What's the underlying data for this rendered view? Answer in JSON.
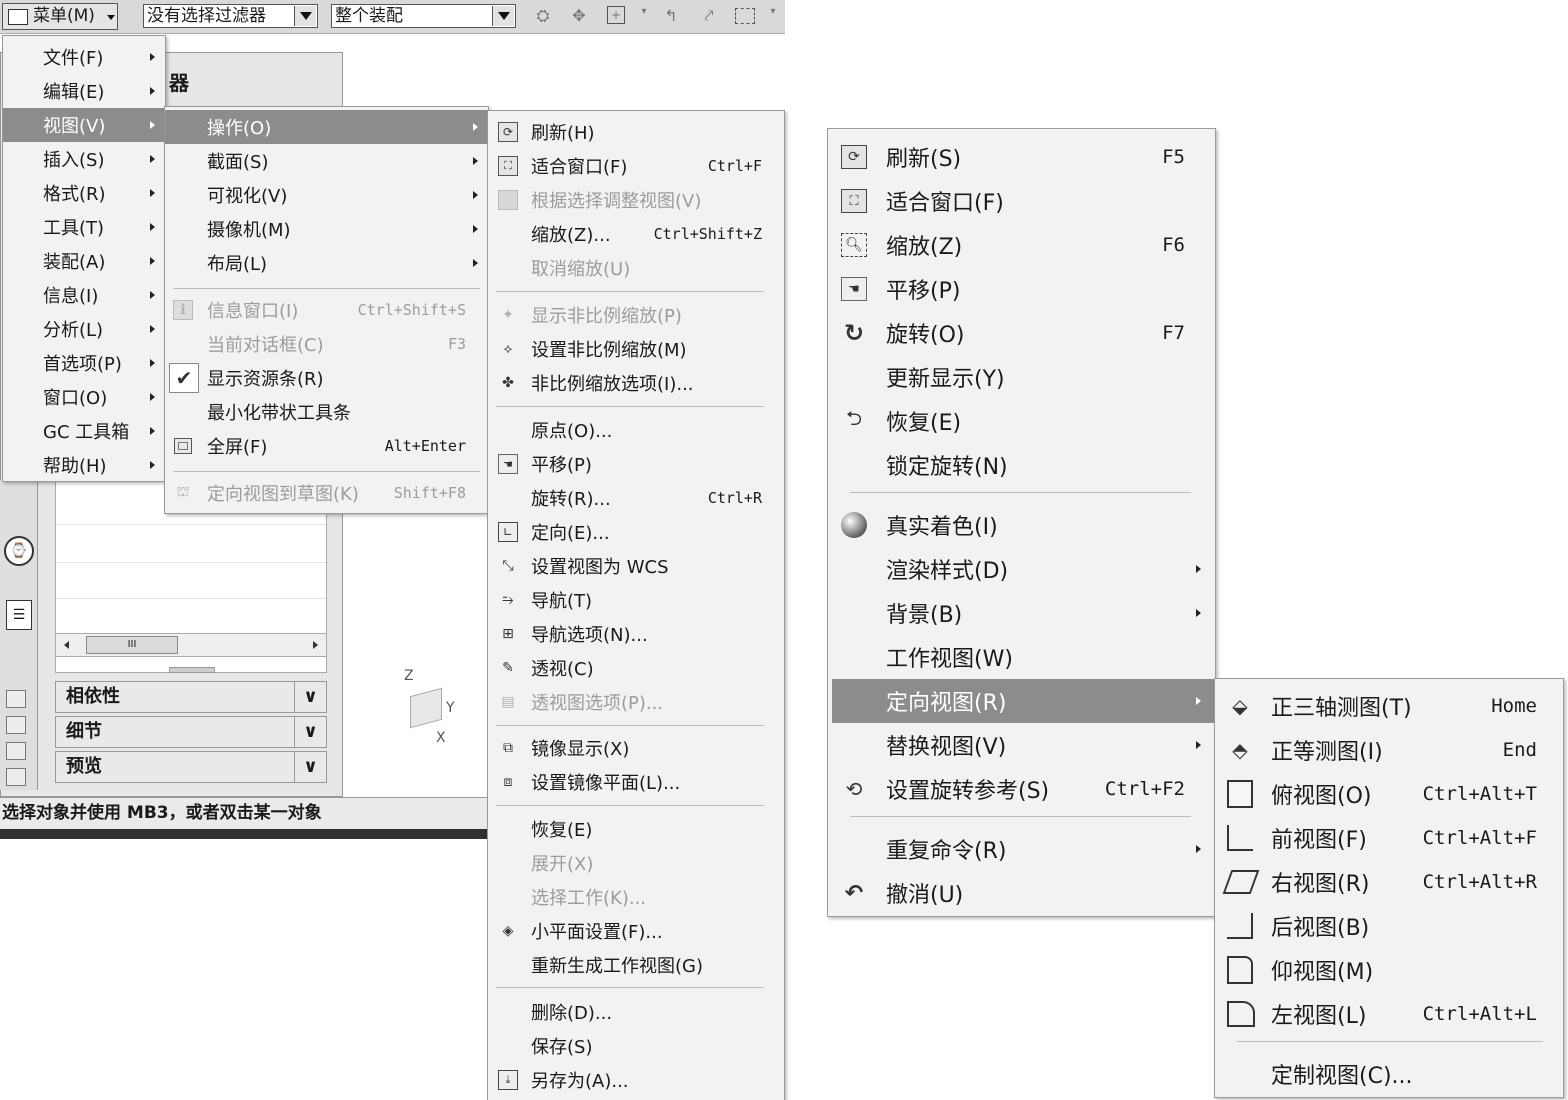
{
  "toolbar": {
    "menu_button": "菜单(M)",
    "filter": "没有选择过滤器",
    "scope": "整个装配"
  },
  "panel": {
    "title_fragment": "器",
    "sections": [
      "相依性",
      "细节",
      "预览"
    ],
    "status": "选择对象并使用 MB3，或者双击某一对象",
    "scroll_mark": "III"
  },
  "axes": {
    "z": "Z",
    "y": "Y",
    "x": "X"
  },
  "main_menu": [
    {
      "label": "文件(F)"
    },
    {
      "label": "编辑(E)"
    },
    {
      "label": "视图(V)"
    },
    {
      "label": "插入(S)"
    },
    {
      "label": "格式(R)"
    },
    {
      "label": "工具(T)"
    },
    {
      "label": "装配(A)"
    },
    {
      "label": "信息(I)"
    },
    {
      "label": "分析(L)"
    },
    {
      "label": "首选项(P)"
    },
    {
      "label": "窗口(O)"
    },
    {
      "label": "GC 工具箱"
    },
    {
      "label": "帮助(H)"
    }
  ],
  "view_menu": [
    {
      "label": "操作(O)",
      "shortcut": ""
    },
    {
      "label": "截面(S)",
      "shortcut": ""
    },
    {
      "label": "可视化(V)",
      "shortcut": ""
    },
    {
      "label": "摄像机(M)",
      "shortcut": ""
    },
    {
      "label": "布局(L)",
      "shortcut": ""
    },
    {
      "label": "信息窗口(I)",
      "shortcut": "Ctrl+Shift+S"
    },
    {
      "label": "当前对话框(C)",
      "shortcut": "F3"
    },
    {
      "label": "显示资源条(R)",
      "shortcut": ""
    },
    {
      "label": "最小化带状工具条",
      "shortcut": ""
    },
    {
      "label": "全屏(F)",
      "shortcut": "Alt+Enter"
    },
    {
      "label": "定向视图到草图(K)",
      "shortcut": "Shift+F8"
    }
  ],
  "ops_menu": [
    {
      "label": "刷新(H)",
      "shortcut": ""
    },
    {
      "label": "适合窗口(F)",
      "shortcut": "Ctrl+F"
    },
    {
      "label": "根据选择调整视图(V)",
      "shortcut": ""
    },
    {
      "label": "缩放(Z)...",
      "shortcut": "Ctrl+Shift+Z"
    },
    {
      "label": "取消缩放(U)",
      "shortcut": ""
    },
    {
      "label": "显示非比例缩放(P)",
      "shortcut": ""
    },
    {
      "label": "设置非比例缩放(M)",
      "shortcut": ""
    },
    {
      "label": "非比例缩放选项(I)...",
      "shortcut": ""
    },
    {
      "label": "原点(O)...",
      "shortcut": ""
    },
    {
      "label": "平移(P)",
      "shortcut": ""
    },
    {
      "label": "旋转(R)...",
      "shortcut": "Ctrl+R"
    },
    {
      "label": "定向(E)...",
      "shortcut": ""
    },
    {
      "label": "设置视图为 WCS",
      "shortcut": ""
    },
    {
      "label": "导航(T)",
      "shortcut": ""
    },
    {
      "label": "导航选项(N)...",
      "shortcut": ""
    },
    {
      "label": "透视(C)",
      "shortcut": ""
    },
    {
      "label": "透视图选项(P)...",
      "shortcut": ""
    },
    {
      "label": "镜像显示(X)",
      "shortcut": ""
    },
    {
      "label": "设置镜像平面(L)...",
      "shortcut": ""
    },
    {
      "label": "恢复(E)",
      "shortcut": ""
    },
    {
      "label": "展开(X)",
      "shortcut": ""
    },
    {
      "label": "选择工作(K)...",
      "shortcut": ""
    },
    {
      "label": "小平面设置(F)...",
      "shortcut": ""
    },
    {
      "label": "重新生成工作视图(G)",
      "shortcut": ""
    },
    {
      "label": "删除(D)...",
      "shortcut": ""
    },
    {
      "label": "保存(S)",
      "shortcut": ""
    },
    {
      "label": "另存为(A)...",
      "shortcut": ""
    }
  ],
  "context_menu": [
    {
      "label": "刷新(S)",
      "shortcut": "F5"
    },
    {
      "label": "适合窗口(F)",
      "shortcut": ""
    },
    {
      "label": "缩放(Z)",
      "shortcut": "F6"
    },
    {
      "label": "平移(P)",
      "shortcut": ""
    },
    {
      "label": "旋转(O)",
      "shortcut": "F7"
    },
    {
      "label": "更新显示(Y)",
      "shortcut": ""
    },
    {
      "label": "恢复(E)",
      "shortcut": ""
    },
    {
      "label": "锁定旋转(N)",
      "shortcut": ""
    },
    {
      "label": "真实着色(I)",
      "shortcut": ""
    },
    {
      "label": "渲染样式(D)",
      "shortcut": ""
    },
    {
      "label": "背景(B)",
      "shortcut": ""
    },
    {
      "label": "工作视图(W)",
      "shortcut": ""
    },
    {
      "label": "定向视图(R)",
      "shortcut": ""
    },
    {
      "label": "替换视图(V)",
      "shortcut": ""
    },
    {
      "label": "设置旋转参考(S)",
      "shortcut": "Ctrl+F2"
    },
    {
      "label": "重复命令(R)",
      "shortcut": ""
    },
    {
      "label": "撤消(U)",
      "shortcut": ""
    }
  ],
  "orient_menu": [
    {
      "label": "正三轴测图(T)",
      "shortcut": "Home"
    },
    {
      "label": "正等测图(I)",
      "shortcut": "End"
    },
    {
      "label": "俯视图(O)",
      "shortcut": "Ctrl+Alt+T"
    },
    {
      "label": "前视图(F)",
      "shortcut": "Ctrl+Alt+F"
    },
    {
      "label": "右视图(R)",
      "shortcut": "Ctrl+Alt+R"
    },
    {
      "label": "后视图(B)",
      "shortcut": ""
    },
    {
      "label": "仰视图(M)",
      "shortcut": ""
    },
    {
      "label": "左视图(L)",
      "shortcut": "Ctrl+Alt+L"
    },
    {
      "label": "定制视图(C)...",
      "shortcut": ""
    }
  ]
}
